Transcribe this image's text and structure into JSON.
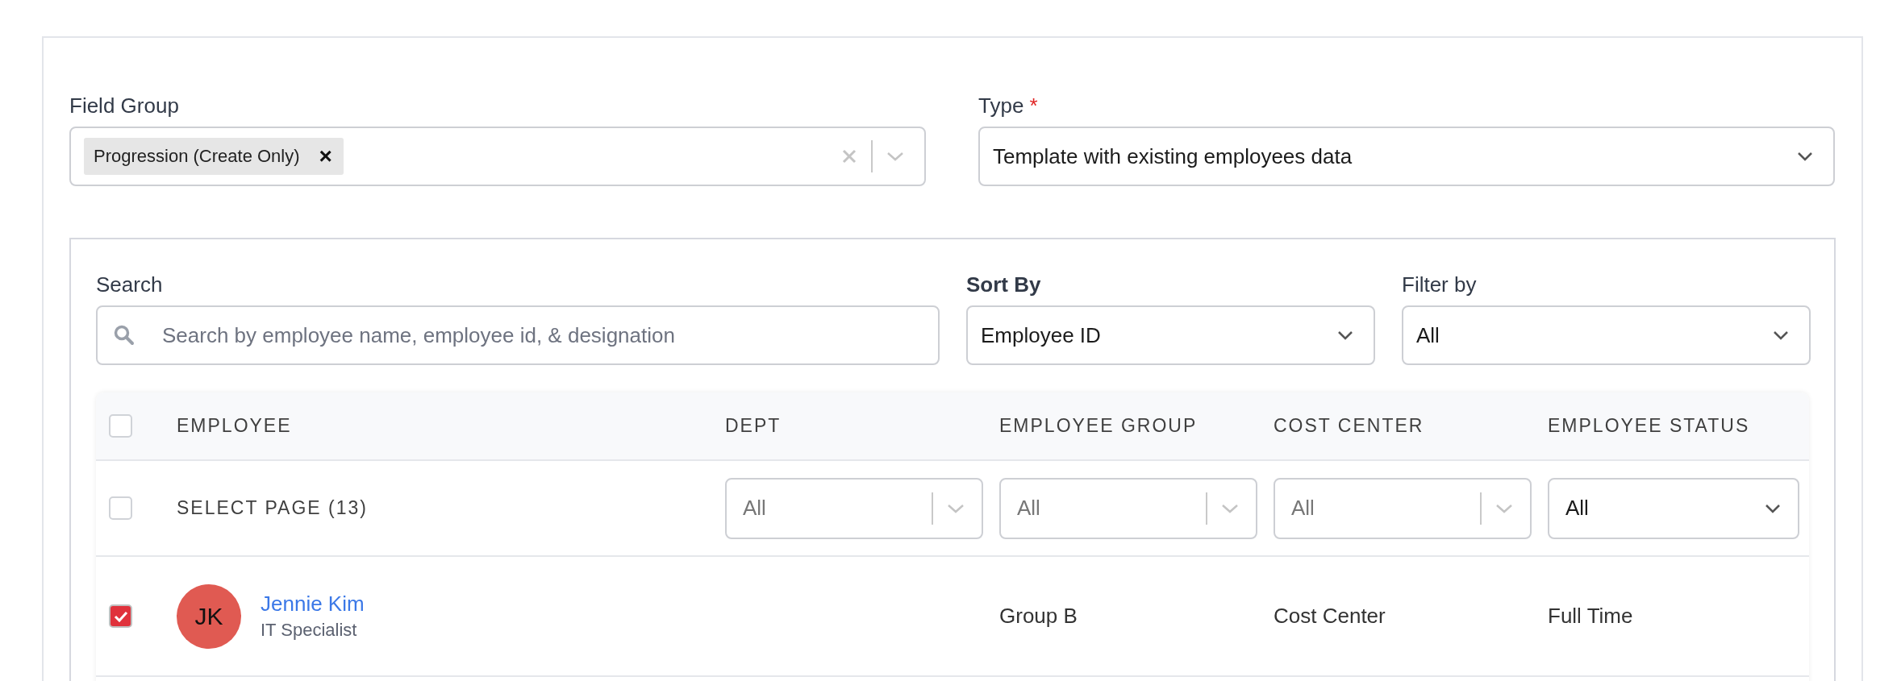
{
  "field_group": {
    "label": "Field Group",
    "tags": [
      {
        "label": "Progression (Create Only)",
        "remove": "×"
      }
    ]
  },
  "type": {
    "label": "Type",
    "required": "*",
    "value": "Template with existing employees data"
  },
  "search": {
    "label": "Search",
    "placeholder": "Search by employee name, employee id, & designation"
  },
  "sort_by": {
    "label": "Sort By",
    "value": "Employee ID"
  },
  "filter_by": {
    "label": "Filter by",
    "value": "All"
  },
  "table": {
    "header_checked": false,
    "columns": [
      "EMPLOYEE",
      "DEPT",
      "EMPLOYEE GROUP",
      "COST CENTER",
      "EMPLOYEE STATUS"
    ],
    "select_page": {
      "label": "SELECT PAGE (13)",
      "checked": false
    },
    "column_filters": [
      {
        "placeholder": "All"
      },
      {
        "placeholder": "All"
      },
      {
        "placeholder": "All"
      },
      {
        "value": "All"
      }
    ],
    "rows": [
      {
        "checked": true,
        "initials": "JK",
        "color": "#e05a52",
        "name": "Jennie Kim",
        "designation": "IT Specialist",
        "group": "Group B",
        "cost_center": "Cost Center",
        "status": "Full Time"
      }
    ]
  }
}
